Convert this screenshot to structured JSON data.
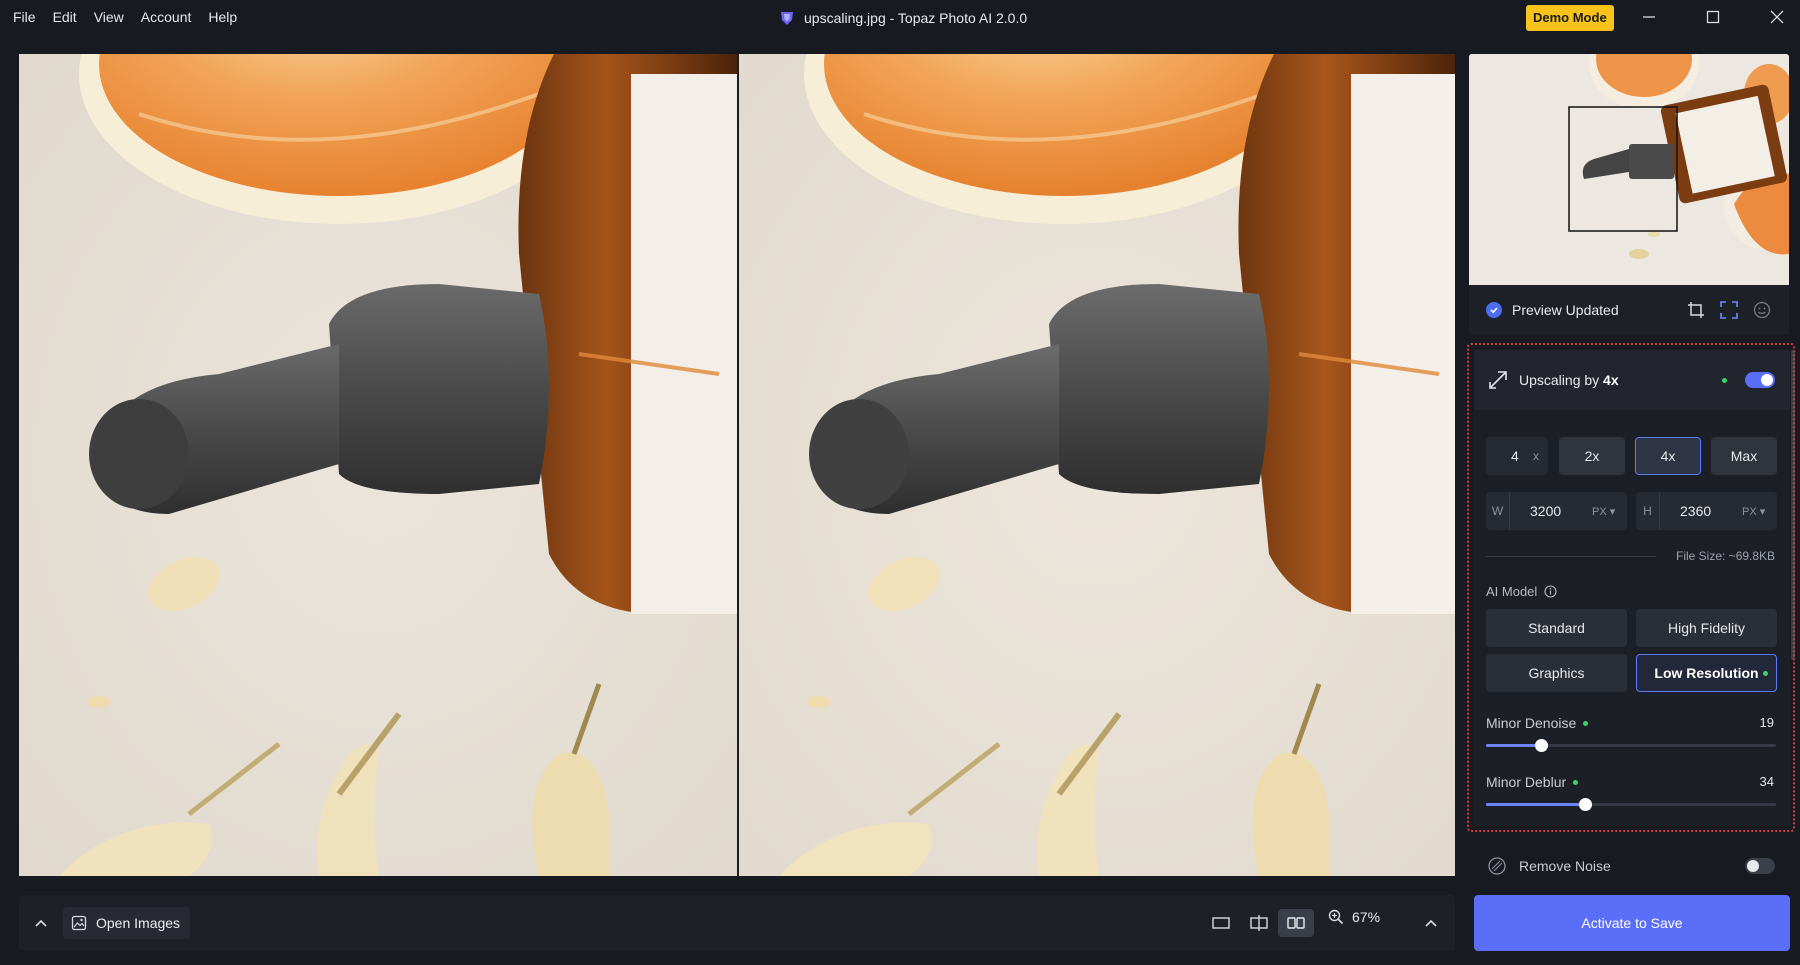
{
  "menu": [
    "File",
    "Edit",
    "View",
    "Account",
    "Help"
  ],
  "window_title": "upscaling.jpg - Topaz Photo AI 2.0.0",
  "demo_badge": "Demo Mode",
  "bottom_bar": {
    "open_images_label": "Open Images",
    "zoom_level": "67%"
  },
  "preview": {
    "status": "Preview Updated"
  },
  "upscaling": {
    "title_prefix": "Upscaling by",
    "title_value": "4x",
    "enabled": true,
    "scale_value": "4",
    "scale_suffix": "x",
    "scale_buttons": [
      "2x",
      "4x",
      "Max"
    ],
    "active_scale": "4x",
    "width_label": "W",
    "width_value": "3200",
    "width_unit": "PX",
    "height_label": "H",
    "height_value": "2360",
    "height_unit": "PX",
    "file_size": "File Size: ~69.8KB",
    "ai_model_label": "AI Model",
    "models": [
      "Standard",
      "High Fidelity",
      "Graphics",
      "Low Resolution"
    ],
    "active_model": "Low Resolution",
    "minor_denoise_label": "Minor Denoise",
    "minor_denoise_value": "19",
    "minor_denoise_level": 0.19,
    "minor_deblur_label": "Minor Deblur",
    "minor_deblur_value": "34",
    "minor_deblur_level": 0.34
  },
  "remove_noise": {
    "label": "Remove Noise",
    "enabled": false
  },
  "activate_label": "Activate to Save",
  "colors": {
    "accent": "#5b6ef7",
    "demo_badge": "#f7c31a",
    "active_border": "#5d7bff",
    "status_green": "#3cd26b",
    "highlight_box": "#d43b3b"
  }
}
